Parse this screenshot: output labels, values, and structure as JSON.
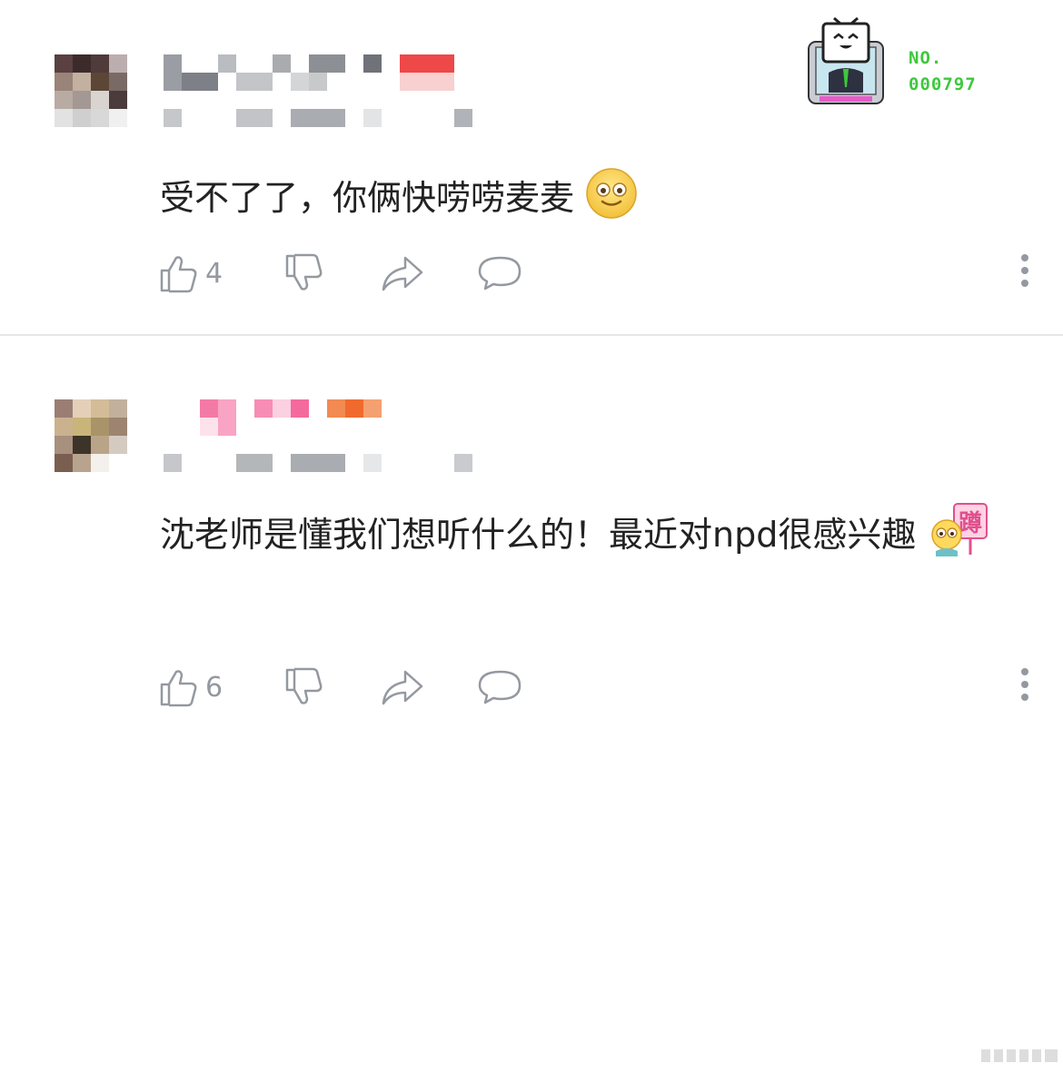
{
  "badge": {
    "line1": "NO.",
    "line2": "000797"
  },
  "comments": [
    {
      "text": "受不了了，你俩快唠唠麦麦",
      "emoji": "smile-face",
      "likes": "4"
    },
    {
      "text": "沈老师是懂我们想听什么的！最近对npd很感兴趣",
      "emoji": "squat-sign",
      "emoji_text": "蹲",
      "likes": "6"
    }
  ],
  "colors": {
    "icon": "#9499a0",
    "text": "#222222",
    "badge_green": "#3ec83c",
    "divider": "#e6e6e6"
  },
  "icons": [
    "thumb-up-icon",
    "thumb-down-icon",
    "share-icon",
    "reply-icon",
    "more-icon"
  ]
}
